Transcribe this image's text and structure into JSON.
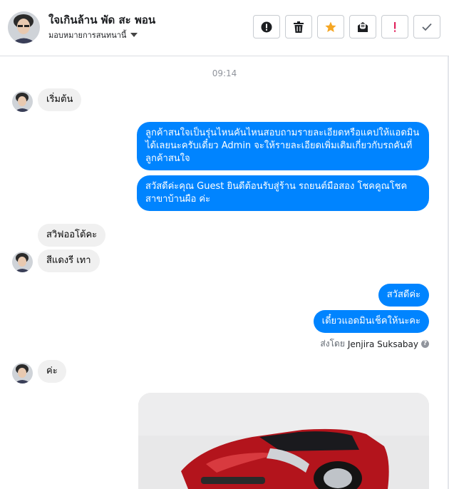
{
  "header": {
    "contact_name": "ใจเกินล้าน พัด สะ พอน",
    "assign_label": "มอบหมายการสนทนานี้",
    "actions": [
      {
        "name": "report-button",
        "icon": "alert-circle-icon"
      },
      {
        "name": "delete-button",
        "icon": "trash-icon"
      },
      {
        "name": "star-button",
        "icon": "star-icon"
      },
      {
        "name": "mark-unread-button",
        "icon": "envelope-icon"
      },
      {
        "name": "important-button",
        "icon": "exclamation-icon"
      },
      {
        "name": "done-button",
        "icon": "check-icon"
      }
    ]
  },
  "colors": {
    "outgoing_bubble": "#0084ff",
    "incoming_bubble": "#f0f0f0",
    "star": "#f5a623",
    "important": "#e0245e"
  },
  "conversation": {
    "timestamp": "09:14",
    "messages": [
      {
        "from": "contact",
        "text": "เริ่มต้น"
      },
      {
        "from": "page",
        "text": "ลูกค้าสนใจเป็นรุ่นไหนคันไหนสอบถามรายละเอียดหรือแคปให้แอดมินได้เลยนะครับเดี๋ยว Admin จะให้รายละเอียดเพิ่มเติมเกี่ยวกับรถคันที่ลูกค้าสนใจ"
      },
      {
        "from": "page",
        "text": "สวัสดีค่ะคุณ Guest ยินดีต้อนรับสู่ร้าน รถยนต์มือสอง โชคคูณโชค สาขาบ้านผือ ค่ะ"
      },
      {
        "from": "contact",
        "text": "สวิฟออโต้คะ"
      },
      {
        "from": "contact",
        "text": "สีแดงรี เทา"
      },
      {
        "from": "page",
        "text": "สวัสดีค่ะ"
      },
      {
        "from": "page",
        "text": "เดี๋ยวแอดมินเช็คให้นะคะ"
      },
      {
        "from": "contact",
        "text": "ค่ะ"
      }
    ],
    "sent_by_label": "ส่งโดย",
    "sent_by_agent": "Jenjira Suksabay"
  }
}
